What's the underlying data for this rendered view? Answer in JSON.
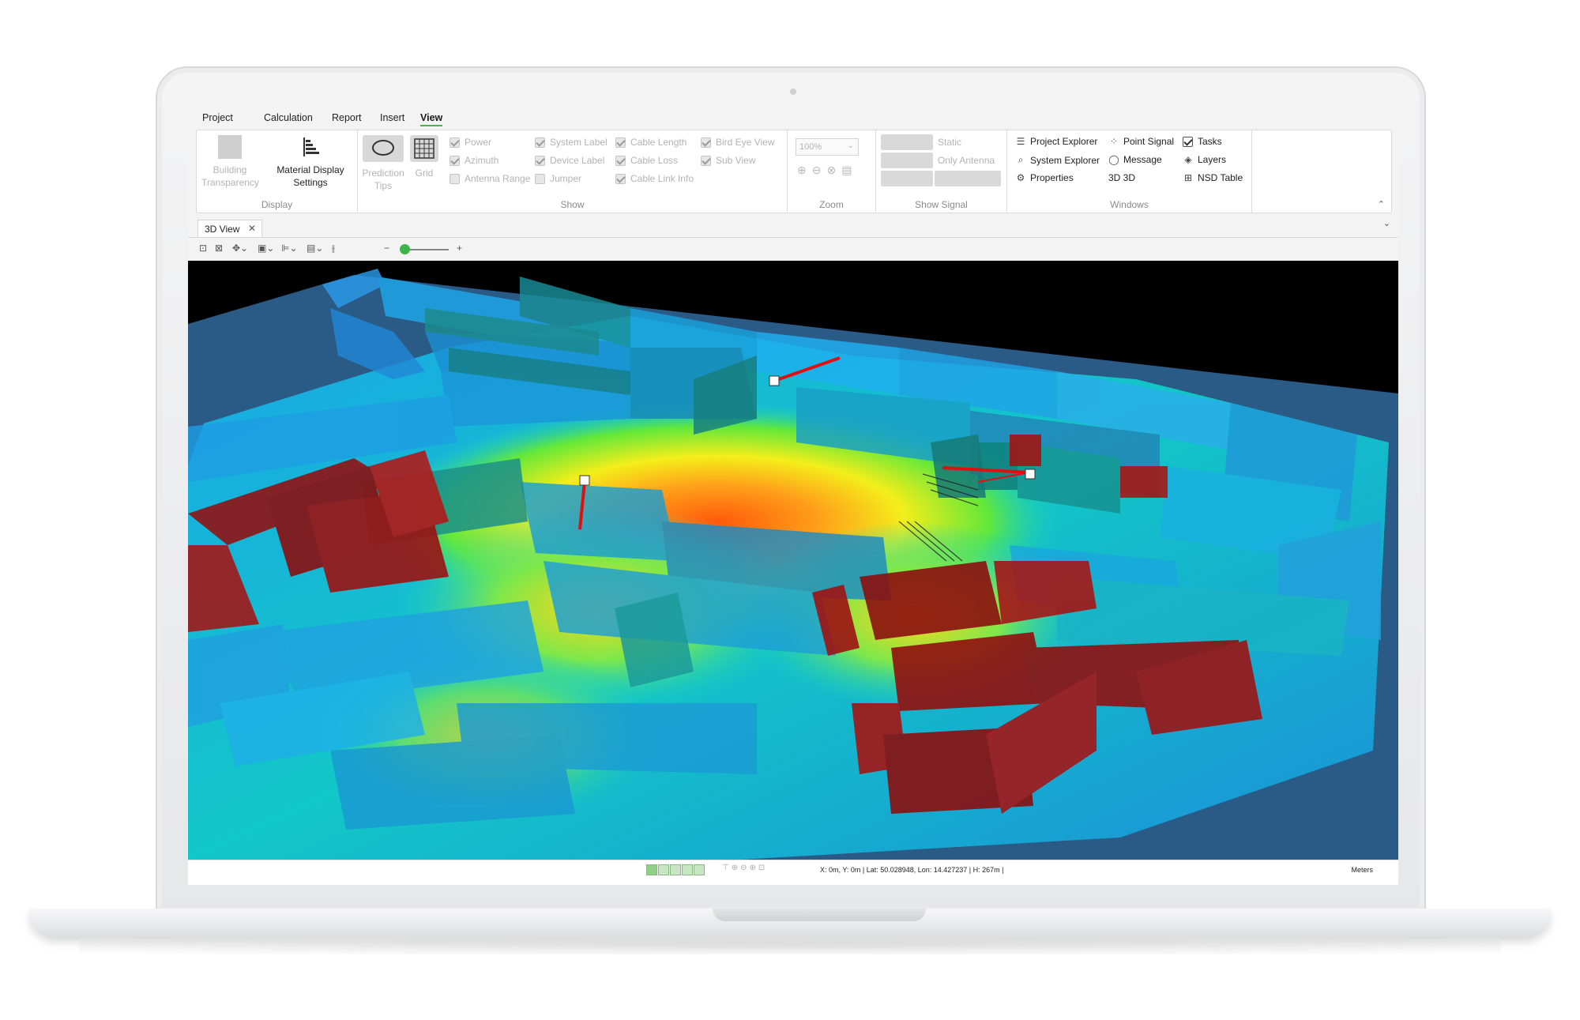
{
  "menu": [
    "Project",
    "Calculation",
    "Report",
    "Insert",
    "View"
  ],
  "active_menu": "View",
  "ribbon": {
    "display": {
      "label": "Display",
      "building_transparency": "Building Transparency",
      "material_display_line1": "Material Display",
      "material_display_line2": "Settings"
    },
    "prediction_tips": "Prediction Tips",
    "grid": "Grid",
    "show": {
      "label": "Show",
      "items": [
        {
          "label": "Power",
          "checked": true
        },
        {
          "label": "Azimuth",
          "checked": true
        },
        {
          "label": "Antenna Range",
          "checked": false
        },
        {
          "label": "System Label",
          "checked": true
        },
        {
          "label": "Device Label",
          "checked": true
        },
        {
          "label": "Jumper",
          "checked": false
        },
        {
          "label": "Cable Length",
          "checked": true
        },
        {
          "label": "Cable Loss",
          "checked": true
        },
        {
          "label": "Cable Link Info",
          "checked": true
        },
        {
          "label": "Bird Eye View",
          "checked": true
        },
        {
          "label": "Sub View",
          "checked": true
        }
      ]
    },
    "zoom": {
      "label": "Zoom",
      "value": "100%"
    },
    "show_signal": {
      "label": "Show Signal",
      "static": "Static",
      "only_antenna": "Only Antenna"
    },
    "windows": {
      "label": "Windows",
      "project_explorer": "Project Explorer",
      "system_explorer": "System Explorer",
      "properties": "Properties",
      "point_signal": "Point Signal",
      "message": "Message",
      "three_d": "3D 3D",
      "tasks": "Tasks",
      "layers": "Layers",
      "nsd_table": "NSD Table"
    }
  },
  "doc_tab": "3D View",
  "status": {
    "coords": "X: 0m, Y: 0m | Lat: 50.028948, Lon: 14.427237 | H: 267m |",
    "units": "Meters"
  },
  "colors": {
    "accent": "#4caf50",
    "wall_red": "#8f1414",
    "wall_teal": "#1e9a9a",
    "floor_blue": "#2b82e0",
    "heat_orange": "#ff8a1a",
    "background": "#000000"
  }
}
